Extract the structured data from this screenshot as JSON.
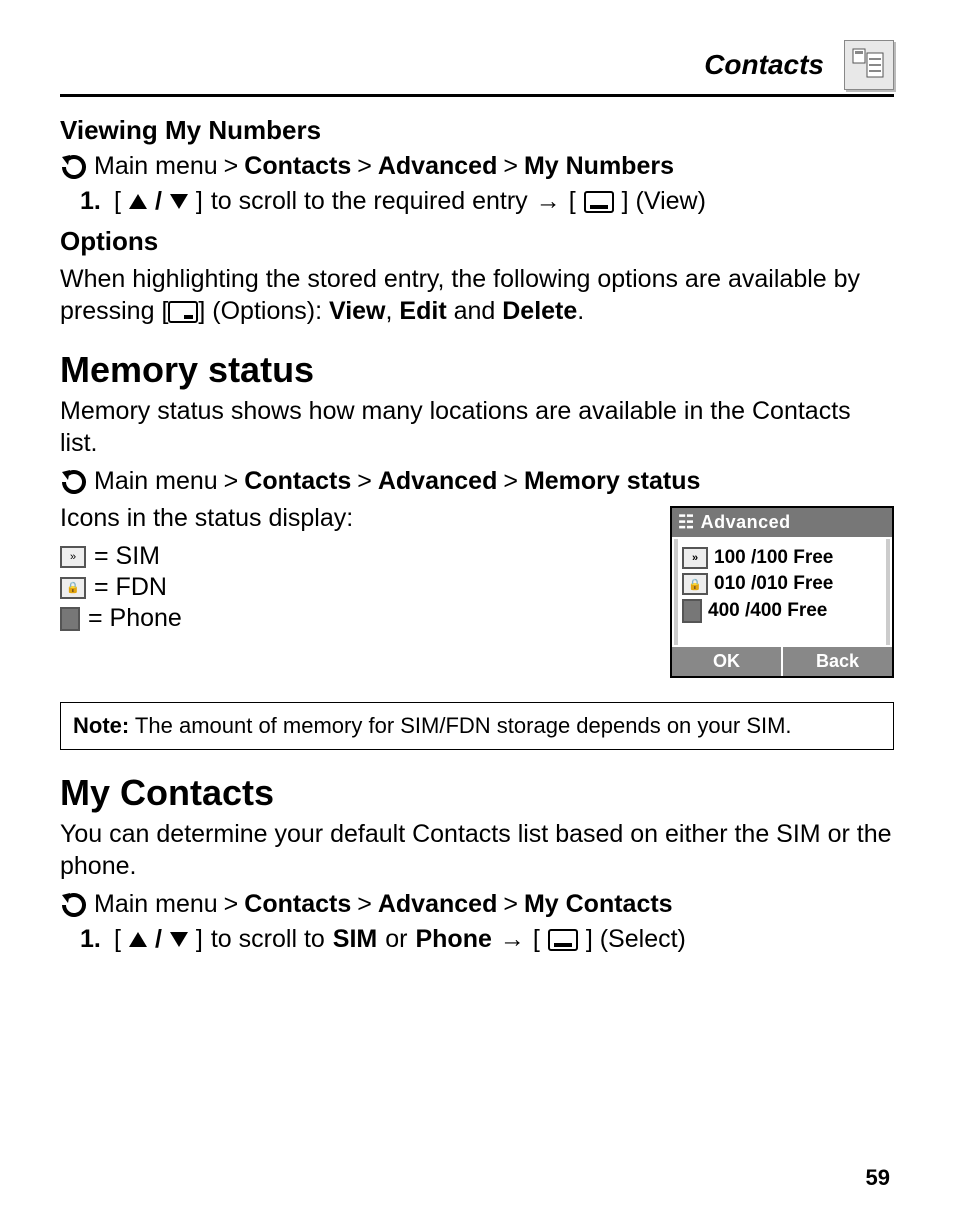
{
  "header": {
    "title": "Contacts"
  },
  "viewing": {
    "heading": "Viewing My Numbers",
    "nav_prefix": "Main menu",
    "nav_1": "Contacts",
    "nav_2": "Advanced",
    "nav_3": "My Numbers",
    "step_num": "1.",
    "step_text_1": "[",
    "step_text_2": " / ",
    "step_text_3": "]",
    "step_text_4": " to scroll to the required entry ",
    "step_text_arrow": "→",
    "step_text_5": " [",
    "step_text_6": "] (View)"
  },
  "options": {
    "heading": "Options",
    "text_1": "When highlighting the stored entry, the following options are available by pressing [",
    "text_2": "] (Options): ",
    "opt_view": "View",
    "comma1": ", ",
    "opt_edit": "Edit",
    "and": " and ",
    "opt_delete": "Delete",
    "period": "."
  },
  "memory": {
    "heading": "Memory status",
    "intro": "Memory status shows how many locations are available in the Contacts list.",
    "nav_prefix": "Main menu",
    "nav_1": "Contacts",
    "nav_2": "Advanced",
    "nav_3": "Memory status",
    "icons_label": "Icons in the status display:",
    "legend_sim": " = SIM",
    "legend_fdn": " = FDN",
    "legend_phone": " = Phone"
  },
  "phone_shot": {
    "title": "Advanced",
    "rows": [
      {
        "value": "100  /100 Free"
      },
      {
        "value": "010  /010 Free"
      },
      {
        "value": "400 /400 Free"
      }
    ],
    "ok": "OK",
    "back": "Back"
  },
  "note": {
    "label": "Note:",
    "text": " The amount of memory for SIM/FDN storage depends on your SIM."
  },
  "mycontacts": {
    "heading": "My Contacts",
    "intro": "You can determine your default Contacts list based on either the SIM or the phone.",
    "nav_prefix": "Main menu",
    "nav_1": "Contacts",
    "nav_2": "Advanced",
    "nav_3": "My Contacts",
    "step_num": "1.",
    "step_text_1": "[",
    "step_text_2": " / ",
    "step_text_3": "]",
    "step_text_4": " to scroll to ",
    "sim": "SIM",
    "or": " or ",
    "phone": "Phone",
    "arrow": " → ",
    "step_text_5": "[",
    "step_text_6": "] (Select)"
  },
  "page_number": "59"
}
